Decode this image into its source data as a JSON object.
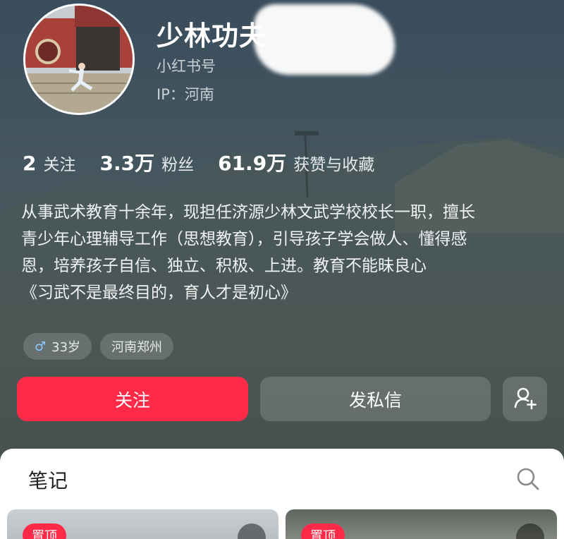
{
  "profile": {
    "name": "少林功夫",
    "red_id_label": "小红书号",
    "ip_label": "IP：河南"
  },
  "stats": [
    {
      "value": "2",
      "label": "关注"
    },
    {
      "value": "3.3万",
      "label": "粉丝"
    },
    {
      "value": "61.9万",
      "label": "获赞与收藏"
    }
  ],
  "bio": [
    "从事武术教育十余年，现担任济源少林文武学校校长一职，擅长",
    "青少年心理辅导工作（思想教育），引导孩子学会做人、懂得感",
    "恩，培养孩子自信、独立、积极、上进。教育不能昧良心",
    "《习武不是最终目的，育人才是初心》"
  ],
  "tags": {
    "age": {
      "icon": "male-icon",
      "text": "33岁"
    },
    "location": "河南郑州"
  },
  "actions": {
    "follow": "关注",
    "message": "发私信",
    "add_friend_icon": "add-user-icon"
  },
  "notes": {
    "title": "笔记",
    "search_icon": "search-icon",
    "items": [
      {
        "badge": "置顶"
      },
      {
        "badge": "置顶"
      }
    ]
  },
  "colors": {
    "accent": "#ff2a48",
    "panel": "#ffffff"
  }
}
